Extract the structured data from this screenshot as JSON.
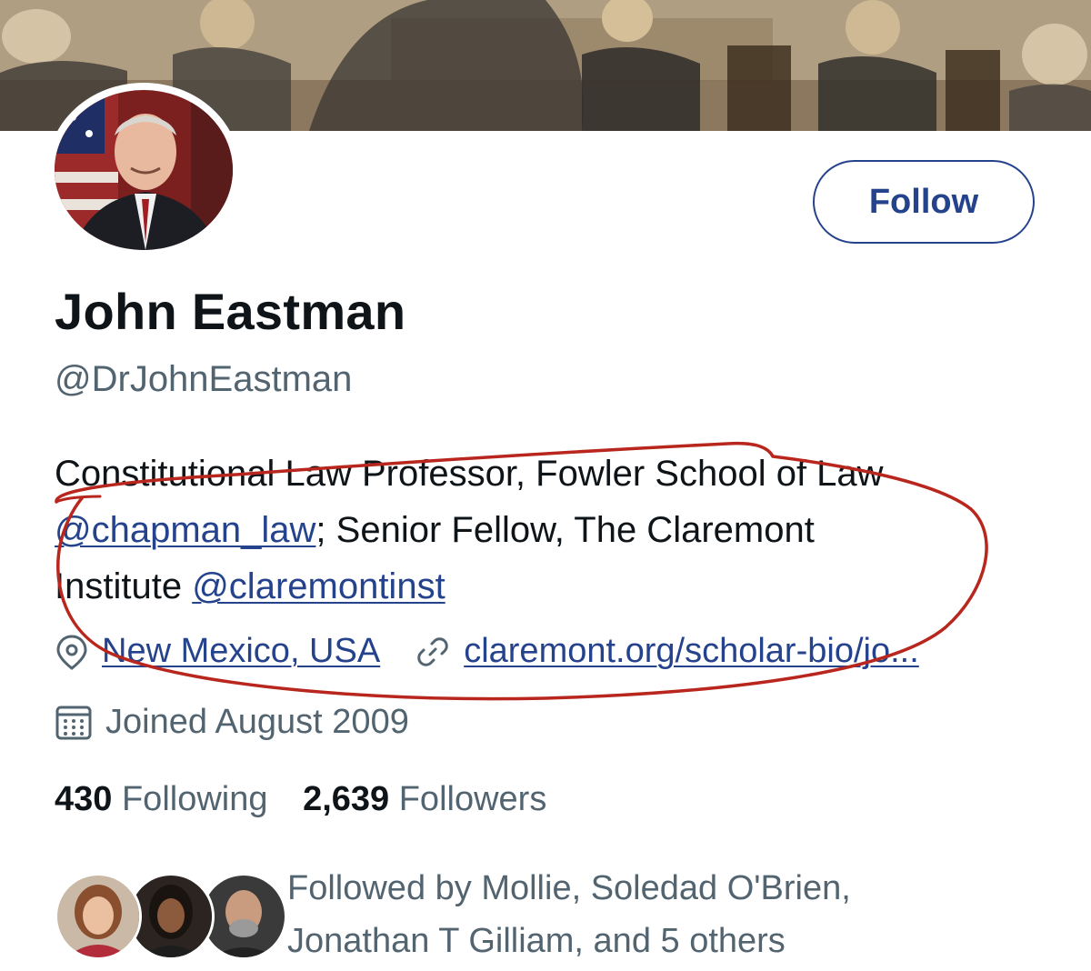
{
  "profile": {
    "display_name": "John Eastman",
    "handle": "@DrJohnEastman",
    "follow_button_label": "Follow"
  },
  "bio": {
    "line1_text": "Constitutional Law Professor, Fowler School of Law",
    "line2_link": "@chapman_law",
    "line2_text": "; Senior Fellow, The Claremont",
    "line3_text": "Institute ",
    "line3_link": "@claremontinst"
  },
  "meta": {
    "location_icon": "location-pin-icon",
    "location": "New Mexico, USA",
    "website_icon": "link-icon",
    "website": "claremont.org/scholar-bio/jo...",
    "joined_icon": "calendar-icon",
    "joined": "Joined August 2009"
  },
  "stats": {
    "following_count": "430",
    "following_label": "Following",
    "followers_count": "2,639",
    "followers_label": "Followers"
  },
  "followed_by": {
    "line1": "Followed by Mollie, Soledad O'Brien,",
    "line2": "Jonathan T Gilliam, and 5 others"
  },
  "colors": {
    "accent": "#25428c",
    "text_primary": "#0f1419",
    "text_secondary": "#536471",
    "annotation_red": "#b8261d"
  }
}
